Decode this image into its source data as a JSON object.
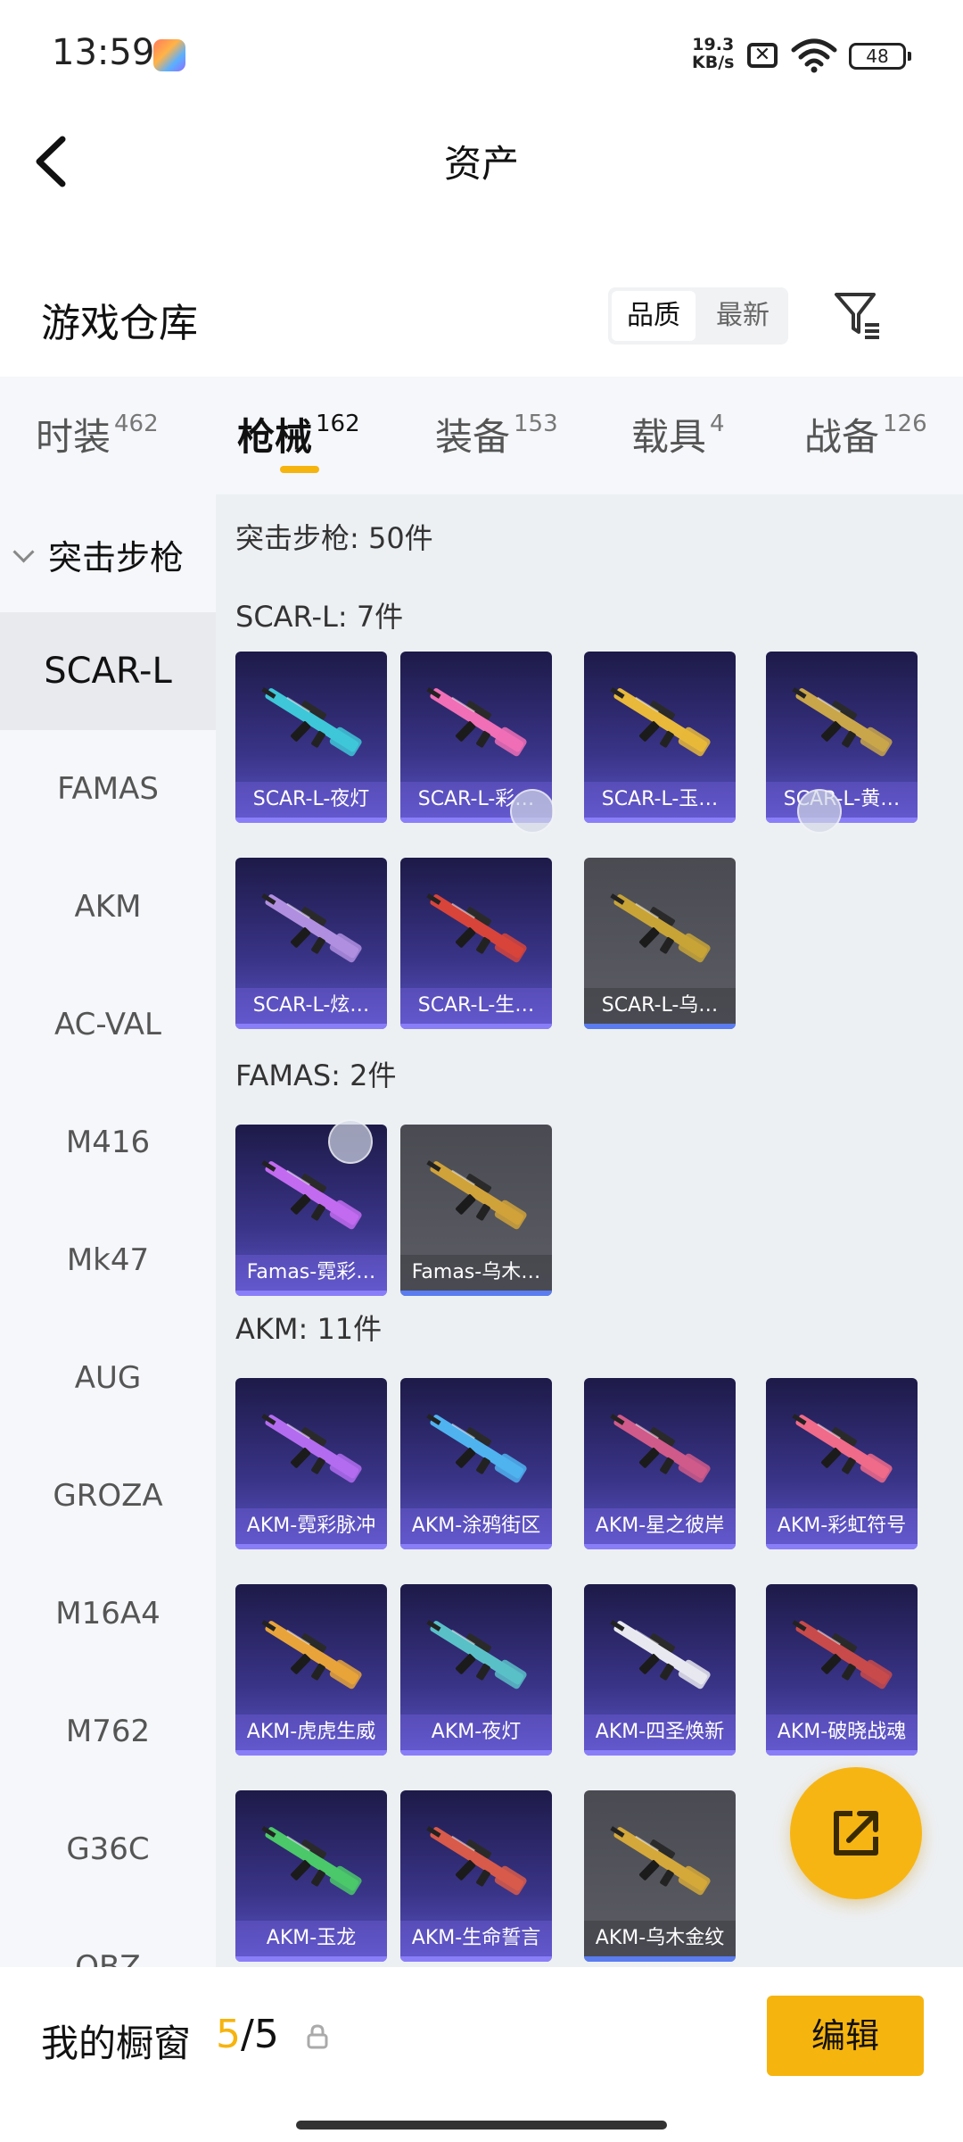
{
  "status_bar": {
    "time": "13:59",
    "net_speed_value": "19.3",
    "net_speed_unit": "KB/s",
    "sim_symbol": "✕",
    "battery": "48"
  },
  "header": {
    "title": "资产"
  },
  "section": {
    "title": "游戏仓库",
    "sort_options": [
      "品质",
      "最新"
    ],
    "sort_selected": "品质"
  },
  "tabs": [
    {
      "name": "时装",
      "count": "462"
    },
    {
      "name": "枪械",
      "count": "162"
    },
    {
      "name": "装备",
      "count": "153"
    },
    {
      "name": "载具",
      "count": "4"
    },
    {
      "name": "战备",
      "count": "126"
    }
  ],
  "active_tab": "枪械",
  "sidebar": {
    "group_label": "突击步枪",
    "items": [
      "SCAR-L",
      "FAMAS",
      "AKM",
      "AC-VAL",
      "M416",
      "Mk47",
      "AUG",
      "GROZA",
      "M16A4",
      "M762",
      "G36C",
      "QBZ"
    ],
    "selected": "SCAR-L"
  },
  "content": {
    "summary": "突击步枪: 50件",
    "groups": [
      {
        "heading": "SCAR-L: 7件",
        "items": [
          {
            "label": "SCAR-L-夜灯",
            "style": "purple",
            "accent": "#3ec7d8"
          },
          {
            "label": "SCAR-L-彩…",
            "style": "purple",
            "accent": "#f06fb6"
          },
          {
            "label": "SCAR-L-玉…",
            "style": "purple",
            "accent": "#e8b93a"
          },
          {
            "label": "SCAR-L-黄…",
            "style": "purple",
            "accent": "#c9a64a"
          },
          {
            "label": "SCAR-L-炫…",
            "style": "purple",
            "accent": "#b08fe0"
          },
          {
            "label": "SCAR-L-生…",
            "style": "purple",
            "accent": "#d8443a"
          },
          {
            "label": "SCAR-L-乌…",
            "style": "grey",
            "accent": "#c8a437"
          }
        ]
      },
      {
        "heading": "FAMAS: 2件",
        "items": [
          {
            "label": "Famas-霓彩…",
            "style": "purple",
            "accent": "#c26bf0"
          },
          {
            "label": "Famas-乌木…",
            "style": "grey",
            "accent": "#d0a23a"
          }
        ]
      },
      {
        "heading": "AKM: 11件",
        "items": [
          {
            "label": "AKM-霓彩脉冲",
            "style": "purple",
            "accent": "#b36cf0"
          },
          {
            "label": "AKM-涂鸦街区",
            "style": "purple",
            "accent": "#4fb3f0"
          },
          {
            "label": "AKM-星之彼岸",
            "style": "purple",
            "accent": "#d05a8a"
          },
          {
            "label": "AKM-彩虹符号",
            "style": "purple",
            "accent": "#f06a8a"
          },
          {
            "label": "AKM-虎虎生威",
            "style": "purple",
            "accent": "#e8a43a"
          },
          {
            "label": "AKM-夜灯",
            "style": "purple",
            "accent": "#5ac0c8"
          },
          {
            "label": "AKM-四圣焕新",
            "style": "purple",
            "accent": "#e8e8f0"
          },
          {
            "label": "AKM-破晓战魂",
            "style": "purple",
            "accent": "#c84a4a"
          },
          {
            "label": "AKM-玉龙",
            "style": "purple",
            "accent": "#4ac86a"
          },
          {
            "label": "AKM-生命誓言",
            "style": "purple",
            "accent": "#d85a4a"
          },
          {
            "label": "AKM-乌木金纹",
            "style": "grey",
            "accent": "#d4a83a"
          }
        ]
      }
    ]
  },
  "showcase": {
    "label": "我的橱窗",
    "used": "5",
    "separator": "/",
    "total": "5",
    "edit_label": "编辑"
  },
  "colors": {
    "accent": "#f6b40e",
    "card_purple": "#3a3488",
    "card_grey": "#5c5d65"
  }
}
